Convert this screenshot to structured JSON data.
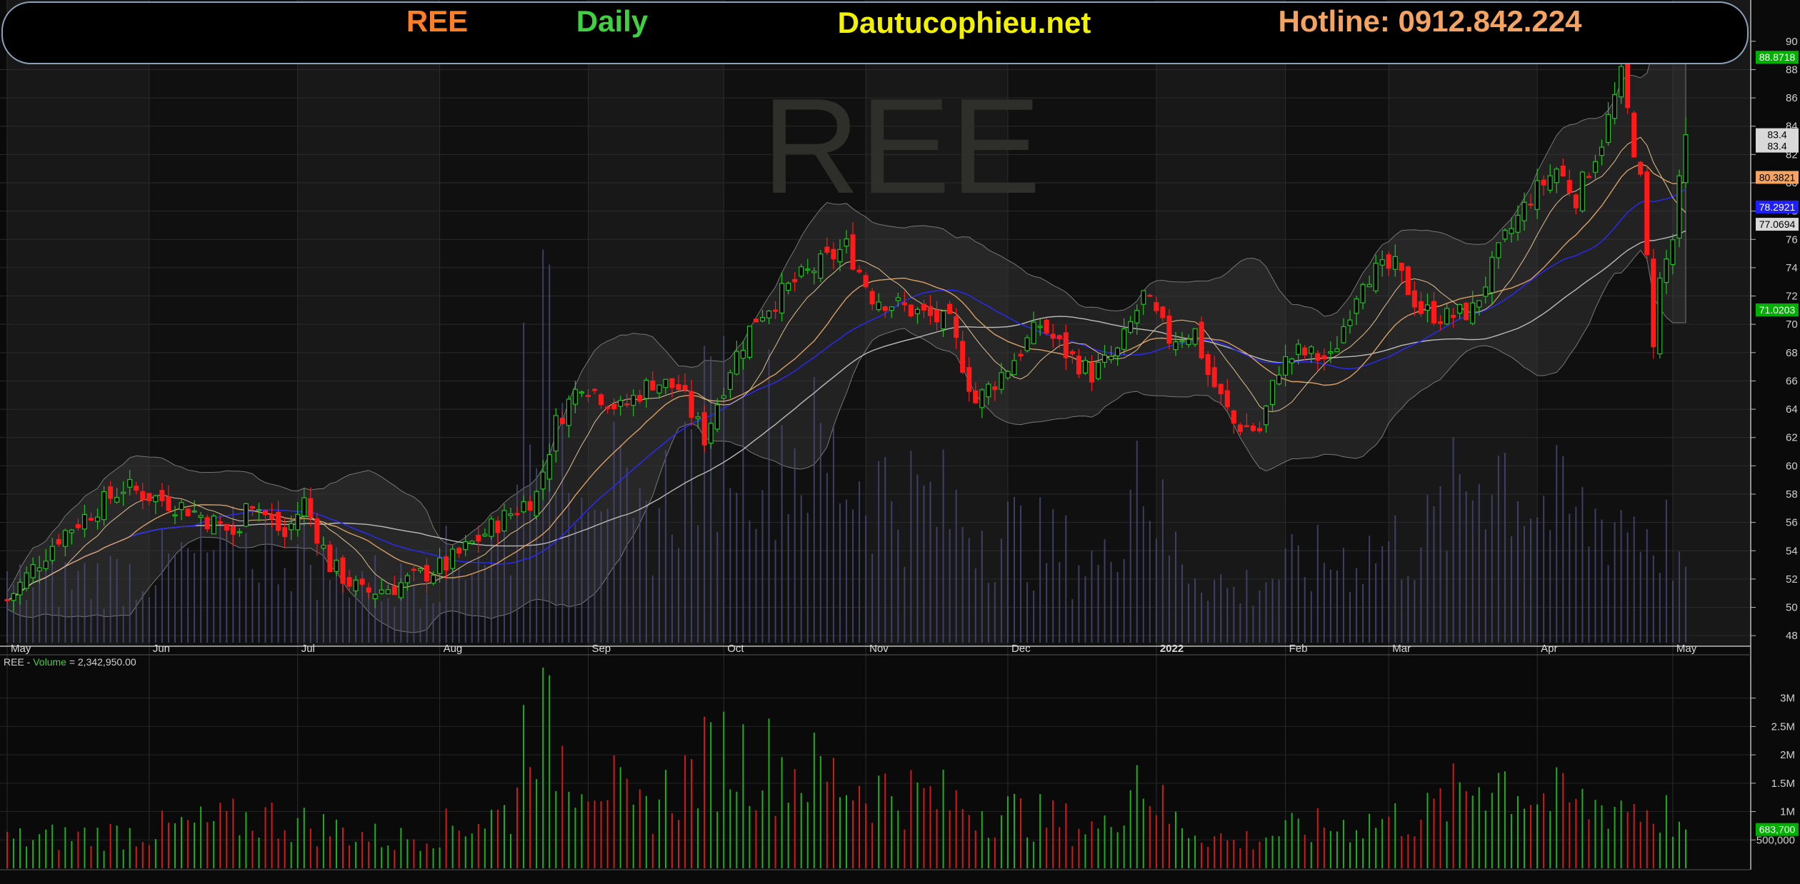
{
  "banner": {
    "ticker": "REE",
    "timeframe": "Daily",
    "site": "Dautucophieu.net",
    "hotline": "Hotline: 0912.842.224",
    "colors": {
      "ticker": "#ff7f27",
      "timeframe": "#3fd13f",
      "site": "#f2f200",
      "hotline": "#f4a460"
    }
  },
  "watermark": "REE",
  "price_axis": {
    "min": 47,
    "max": 91,
    "ticks": [
      "48",
      "50",
      "52",
      "54",
      "56",
      "58",
      "60",
      "62",
      "64",
      "66",
      "68",
      "70",
      "72",
      "74",
      "76",
      "78",
      "80",
      "82",
      "84",
      "86",
      "88",
      "90"
    ]
  },
  "month_labels": [
    "May",
    "Jun",
    "Jul",
    "Aug",
    "Sep",
    "Oct",
    "Nov",
    "Dec",
    "2022",
    "Feb",
    "Mar",
    "Apr",
    "May"
  ],
  "badges": [
    {
      "text": "88.8718",
      "bg": "#00b000",
      "fg": "#ffffff"
    },
    {
      "text": "83.4",
      "bg": "#d9d9d9",
      "fg": "#000000"
    },
    {
      "text": "83.4",
      "bg": "#d9d9d9",
      "fg": "#000000"
    },
    {
      "text": "80.3821",
      "bg": "#f4a460",
      "fg": "#000000"
    },
    {
      "text": "78.2921",
      "bg": "#1e1eff",
      "fg": "#ffffff"
    },
    {
      "text": "77.0694",
      "bg": "#d9d9d9",
      "fg": "#000000"
    },
    {
      "text": "71.0203",
      "bg": "#00b000",
      "fg": "#ffffff"
    }
  ],
  "volume_panel": {
    "label_prefix": "REE - ",
    "label_volume": "Volume",
    "label_value": " = 2,342,950.00",
    "ticks": [
      "500,000",
      "1M",
      "1.5M",
      "2M",
      "2.5M",
      "3M"
    ],
    "last_badge": "683,700"
  },
  "chart_data": {
    "type": "candlestick",
    "title": "REE Daily",
    "ylim": [
      47,
      91
    ],
    "series_notes": [
      "price candlesticks",
      "moving averages",
      "bollinger bands",
      "volume bars"
    ],
    "months": [
      "May",
      "Jun",
      "Jul",
      "Aug",
      "Sep",
      "Oct",
      "Nov",
      "Dec",
      "2022",
      "Feb",
      "Mar",
      "Apr",
      "May"
    ],
    "month_anchor_days": [
      0,
      22,
      45,
      67,
      90,
      111,
      133,
      155,
      178,
      198,
      214,
      237,
      258
    ],
    "close_anchors": [
      [
        0,
        50.5
      ],
      [
        8,
        55
      ],
      [
        18,
        58.5
      ],
      [
        28,
        57
      ],
      [
        36,
        55
      ],
      [
        37,
        58
      ],
      [
        43,
        55
      ],
      [
        46,
        57.5
      ],
      [
        50,
        53
      ],
      [
        55,
        51
      ],
      [
        60,
        51.5
      ],
      [
        68,
        53
      ],
      [
        76,
        56
      ],
      [
        82,
        58
      ],
      [
        85,
        63
      ],
      [
        89,
        66
      ],
      [
        95,
        64
      ],
      [
        100,
        66
      ],
      [
        104,
        65.5
      ],
      [
        108,
        62
      ],
      [
        112,
        67
      ],
      [
        116,
        70.5
      ],
      [
        122,
        73
      ],
      [
        130,
        75.5
      ],
      [
        134,
        72
      ],
      [
        140,
        71
      ],
      [
        146,
        70
      ],
      [
        150,
        64.5
      ],
      [
        155,
        67
      ],
      [
        160,
        70
      ],
      [
        164,
        68
      ],
      [
        168,
        66.5
      ],
      [
        172,
        68
      ],
      [
        176,
        72
      ],
      [
        180,
        69
      ],
      [
        184,
        69.5
      ],
      [
        186,
        66.5
      ],
      [
        190,
        63
      ],
      [
        194,
        62.5
      ],
      [
        197,
        67
      ],
      [
        200,
        68
      ],
      [
        205,
        67.5
      ],
      [
        210,
        73.5
      ],
      [
        215,
        74
      ],
      [
        219,
        71
      ],
      [
        223,
        70.5
      ],
      [
        227,
        71
      ],
      [
        232,
        76
      ],
      [
        236,
        79
      ],
      [
        240,
        81
      ],
      [
        243,
        79
      ],
      [
        247,
        83
      ],
      [
        250,
        87.5
      ],
      [
        253,
        80
      ],
      [
        255,
        69
      ],
      [
        256,
        73
      ],
      [
        258,
        76
      ],
      [
        260,
        83.5
      ]
    ],
    "vol_anchors": [
      [
        0,
        550000
      ],
      [
        20,
        700000
      ],
      [
        40,
        1000000
      ],
      [
        60,
        550000
      ],
      [
        70,
        850000
      ],
      [
        78,
        1100000
      ],
      [
        81,
        3400000
      ],
      [
        85,
        2300000
      ],
      [
        92,
        1900000
      ],
      [
        97,
        1000000
      ],
      [
        111,
        2300000
      ],
      [
        133,
        1600000
      ],
      [
        170,
        750000
      ],
      [
        175,
        2000000
      ],
      [
        180,
        950000
      ],
      [
        190,
        500000
      ],
      [
        197,
        700000
      ],
      [
        220,
        1050000
      ],
      [
        230,
        1900000
      ],
      [
        237,
        1400000
      ],
      [
        245,
        1200000
      ],
      [
        250,
        1300000
      ],
      [
        258,
        1000000
      ],
      [
        260,
        683700
      ]
    ],
    "last_close": 83.4,
    "last_volume": 683700
  }
}
